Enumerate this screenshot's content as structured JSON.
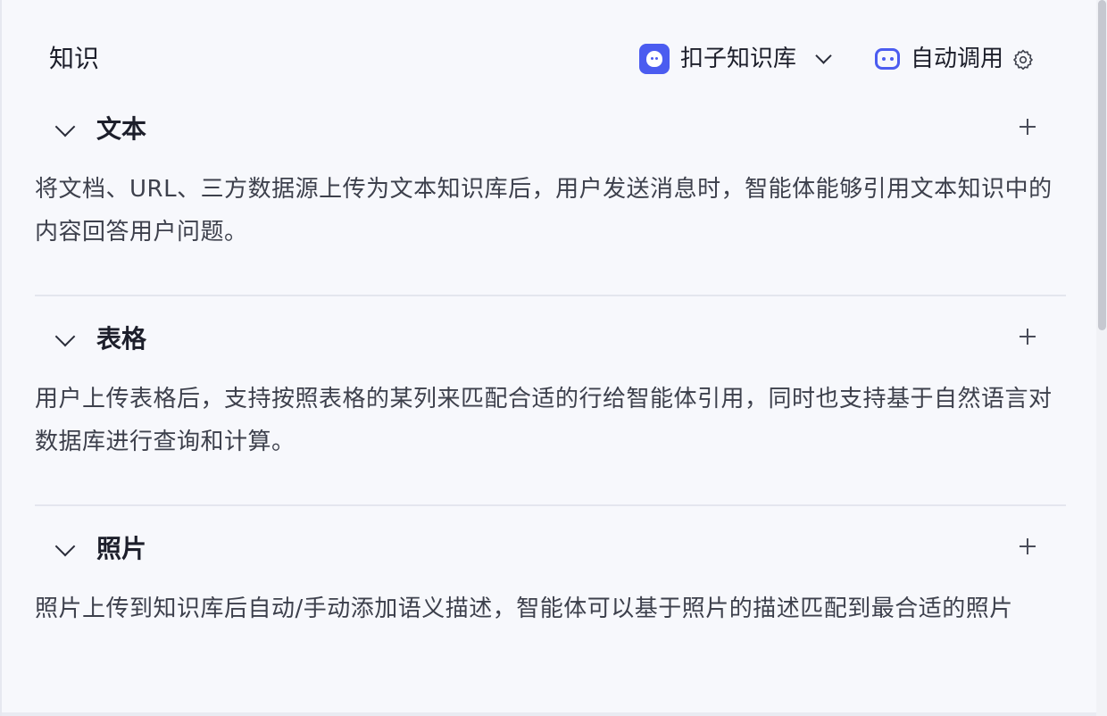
{
  "header": {
    "title": "知识",
    "kb_selector_label": "扣子知识库",
    "auto_call_label": "自动调用",
    "accent_color": "#4b5cf0"
  },
  "sections": [
    {
      "title": "文本",
      "description": "将文档、URL、三方数据源上传为文本知识库后，用户发送消息时，智能体能够引用文本知识中的内容回答用户问题。"
    },
    {
      "title": "表格",
      "description": "用户上传表格后，支持按照表格的某列来匹配合适的行给智能体引用，同时也支持基于自然语言对数据库进行查询和计算。"
    },
    {
      "title": "照片",
      "description": "照片上传到知识库后自动/手动添加语义描述，智能体可以基于照片的描述匹配到最合适的照片"
    }
  ],
  "icons": {
    "kb_logo": "coze-logo-icon",
    "dropdown": "chevron-down-icon",
    "auto_call": "robot-icon",
    "settings": "gear-icon",
    "collapse": "chevron-down-icon",
    "add": "plus-icon"
  }
}
